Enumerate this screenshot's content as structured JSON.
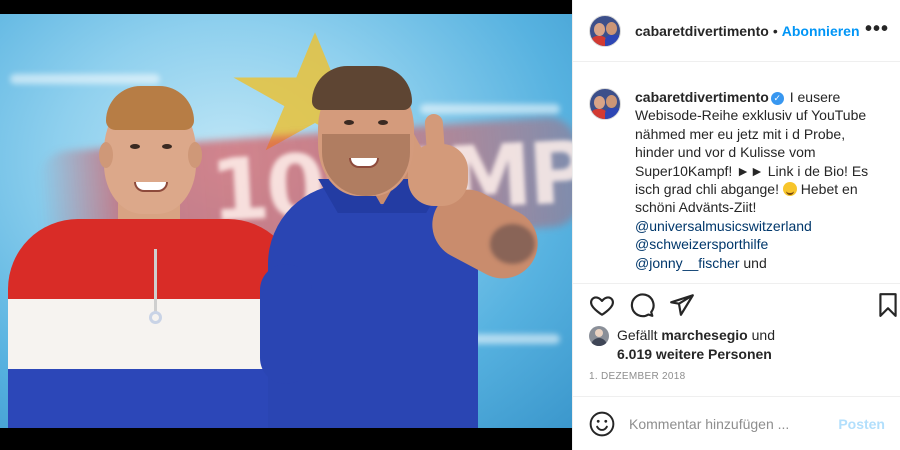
{
  "post": {
    "username": "cabaretdivertimento",
    "follow_label": "Abonnieren",
    "more_icon": "more-options-icon",
    "verified_mark": "✓",
    "caption": {
      "line1": "I eusere Webisode-Reihe exklusiv uf YouTube nähmed mer eu jetz mit i d Probe, hinder und vor d Kulisse vom Super10Kampf! ►► Link i de Bio! Es isch grad chli abgange!",
      "line2": " Hebet en schöni Advänts-Ziit!",
      "mentions": [
        "@universalmusicswitzerland",
        "@schweizersporthilfe"
      ],
      "last_mention": "@jonny__fischer",
      "last_suffix": " und"
    },
    "likes": {
      "prefix": "Gefällt ",
      "user": "marchesegio",
      "joiner": " und",
      "others": "6.019 weitere Personen"
    },
    "date": "1. DEZEMBER 2018",
    "comment": {
      "placeholder": "Kommentar hinzufügen ...",
      "post_label": "Posten"
    },
    "colors": {
      "link_blue": "#0095f6",
      "verified_blue": "#3897f0",
      "mention_blue": "#00376b",
      "muted_grey": "#8e8e8e"
    }
  }
}
